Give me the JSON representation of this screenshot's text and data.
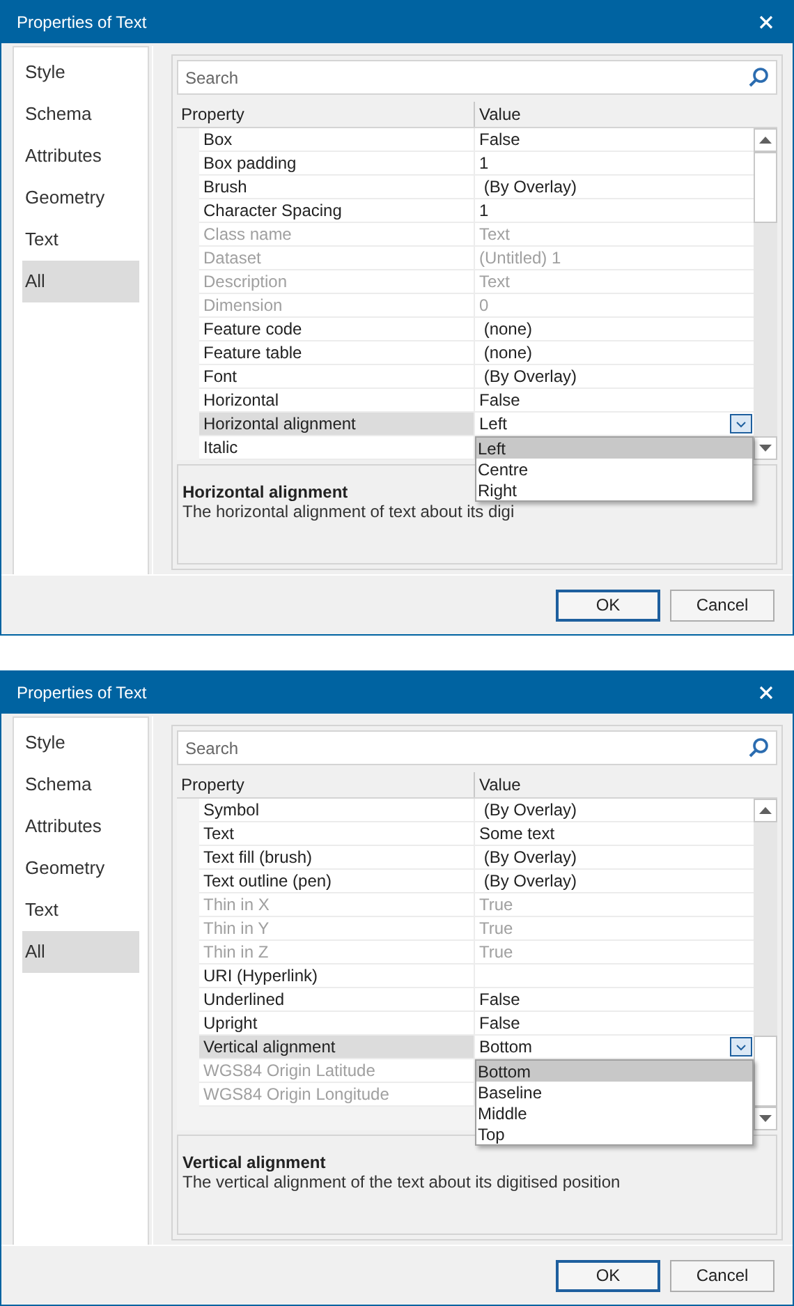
{
  "dialogs": [
    {
      "title": "Properties of Text",
      "nav": [
        {
          "label": "Style",
          "selected": false
        },
        {
          "label": "Schema",
          "selected": false
        },
        {
          "label": "Attributes",
          "selected": false
        },
        {
          "label": "Geometry",
          "selected": false
        },
        {
          "label": "Text",
          "selected": false
        },
        {
          "label": "All",
          "selected": true
        }
      ],
      "search": {
        "placeholder": "Search"
      },
      "columns": [
        "Property",
        "Value"
      ],
      "rows": [
        {
          "property": "Box",
          "value": "False",
          "disabled": false,
          "selected": false
        },
        {
          "property": "Box padding",
          "value": "1",
          "disabled": false,
          "selected": false
        },
        {
          "property": "Brush",
          "value": " (By Overlay)",
          "disabled": false,
          "selected": false
        },
        {
          "property": "Character Spacing",
          "value": "1",
          "disabled": false,
          "selected": false
        },
        {
          "property": "Class name",
          "value": "Text",
          "disabled": true,
          "selected": false
        },
        {
          "property": "Dataset",
          "value": "(Untitled) 1",
          "disabled": true,
          "selected": false
        },
        {
          "property": "Description",
          "value": "Text",
          "disabled": true,
          "selected": false
        },
        {
          "property": "Dimension",
          "value": "0",
          "disabled": true,
          "selected": false
        },
        {
          "property": "Feature code",
          "value": " (none)",
          "disabled": false,
          "selected": false
        },
        {
          "property": "Feature table",
          "value": " (none)",
          "disabled": false,
          "selected": false
        },
        {
          "property": "Font",
          "value": " (By Overlay)",
          "disabled": false,
          "selected": false
        },
        {
          "property": "Horizontal",
          "value": "False",
          "disabled": false,
          "selected": false
        },
        {
          "property": "Horizontal alignment",
          "value": "Left",
          "disabled": false,
          "selected": true
        },
        {
          "property": "Italic",
          "disabled": false,
          "selected": false
        }
      ],
      "dropdown": [
        {
          "label": "Left",
          "selected": true
        },
        {
          "label": "Centre",
          "selected": false
        },
        {
          "label": "Right",
          "selected": false
        }
      ],
      "description": {
        "title": "Horizontal alignment",
        "text": "The horizontal alignment of text about its digi"
      },
      "buttons": [
        {
          "label": "OK",
          "default": true
        },
        {
          "label": "Cancel",
          "default": false
        }
      ]
    },
    {
      "title": "Properties of Text",
      "nav": [
        {
          "label": "Style",
          "selected": false
        },
        {
          "label": "Schema",
          "selected": false
        },
        {
          "label": "Attributes",
          "selected": false
        },
        {
          "label": "Geometry",
          "selected": false
        },
        {
          "label": "Text",
          "selected": false
        },
        {
          "label": "All",
          "selected": true
        }
      ],
      "search": {
        "placeholder": "Search"
      },
      "columns": [
        "Property",
        "Value"
      ],
      "rows": [
        {
          "property": "Symbol",
          "value": " (By Overlay)",
          "disabled": false,
          "selected": false
        },
        {
          "property": "Text",
          "value": "Some text",
          "disabled": false,
          "selected": false
        },
        {
          "property": "Text fill (brush)",
          "value": " (By Overlay)",
          "disabled": false,
          "selected": false
        },
        {
          "property": "Text outline (pen)",
          "value": " (By Overlay)",
          "disabled": false,
          "selected": false
        },
        {
          "property": "Thin in X",
          "value": "True",
          "disabled": true,
          "selected": false
        },
        {
          "property": "Thin in Y",
          "value": "True",
          "disabled": true,
          "selected": false
        },
        {
          "property": "Thin in Z",
          "value": "True",
          "disabled": true,
          "selected": false
        },
        {
          "property": "URI (Hyperlink)",
          "disabled": false,
          "selected": false
        },
        {
          "property": "Underlined",
          "value": "False",
          "disabled": false,
          "selected": false
        },
        {
          "property": "Upright",
          "value": "False",
          "disabled": false,
          "selected": false
        },
        {
          "property": "Vertical alignment",
          "value": "Bottom",
          "disabled": false,
          "selected": true
        },
        {
          "property": "WGS84 Origin Latitude",
          "disabled": true,
          "selected": false
        },
        {
          "property": "WGS84 Origin Longitude",
          "disabled": true,
          "selected": false
        }
      ],
      "dropdown": [
        {
          "label": "Bottom",
          "selected": true
        },
        {
          "label": "Baseline",
          "selected": false
        },
        {
          "label": "Middle",
          "selected": false
        },
        {
          "label": "Top",
          "selected": false
        }
      ],
      "description": {
        "title": "Vertical alignment",
        "text": "The vertical alignment of the text about its digitised position"
      },
      "buttons": [
        {
          "label": "OK",
          "default": true
        },
        {
          "label": "Cancel",
          "default": false
        }
      ]
    }
  ]
}
